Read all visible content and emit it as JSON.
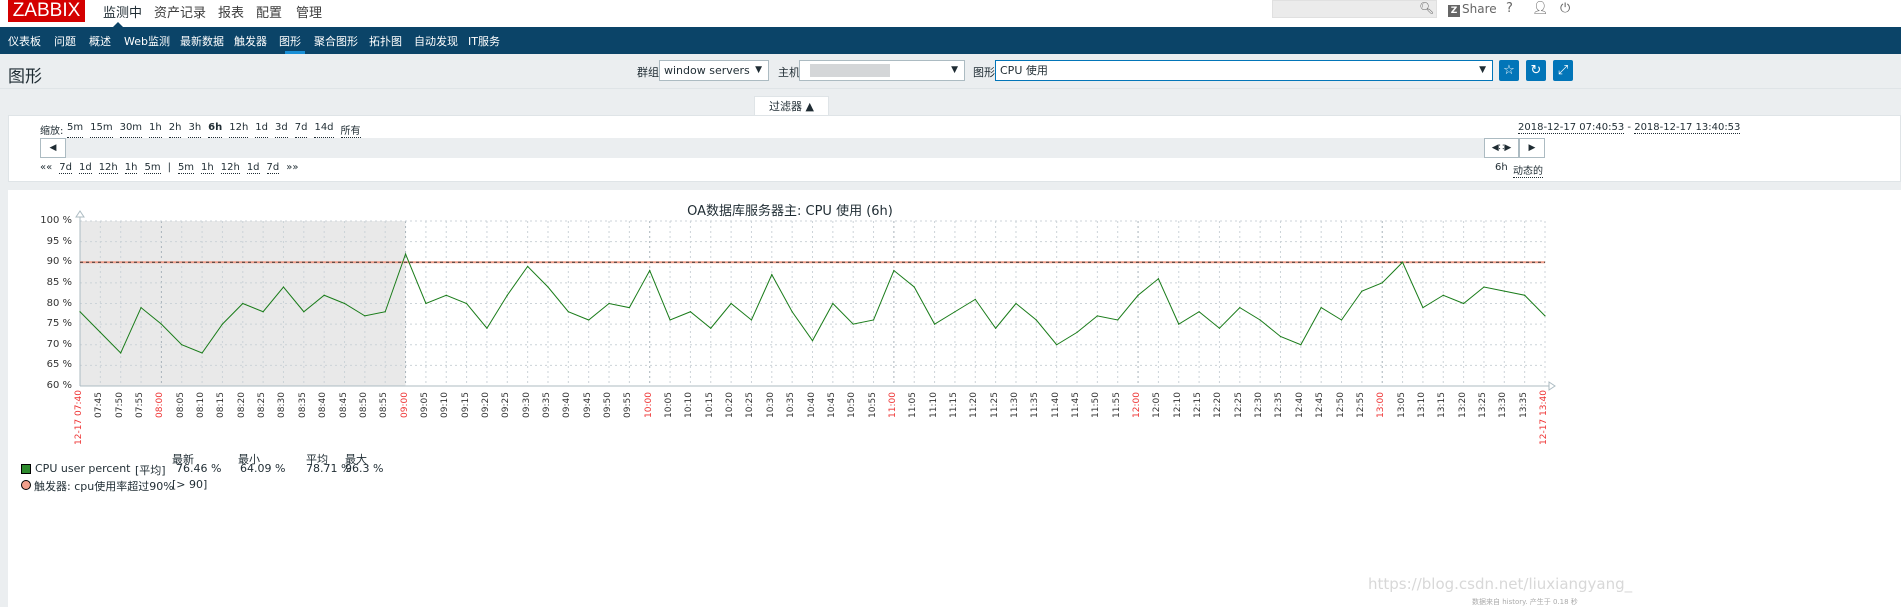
{
  "top": {
    "logo": "ZABBIX",
    "menu": [
      "监测中",
      "资产记录",
      "报表",
      "配置",
      "管理"
    ],
    "active_menu": "监测中",
    "share": "Share",
    "help": "?",
    "search_placeholder": ""
  },
  "nav": {
    "items": [
      "仪表板",
      "问题",
      "概述",
      "Web监测",
      "最新数据",
      "触发器",
      "图形",
      "聚合图形",
      "拓扑图",
      "自动发现",
      "IT服务"
    ],
    "active": "图形"
  },
  "header": {
    "title": "图形",
    "group_label": "群组",
    "group_value": "window servers",
    "host_label": "主机",
    "host_value": "",
    "graph_label": "图形",
    "graph_value": "CPU 使用"
  },
  "filter": {
    "tab": "过滤器 ▲",
    "zoom_label": "缩放:",
    "zoom_options": [
      "5m",
      "15m",
      "30m",
      "1h",
      "2h",
      "3h",
      "6h",
      "12h",
      "1d",
      "3d",
      "7d",
      "14d",
      "所有"
    ],
    "zoom_active": "6h",
    "from": "2018-12-17 07:40:53",
    "to": "2018-12-17 13:40:53",
    "sep": "-",
    "nav_back": [
      "««",
      "7d",
      "1d",
      "12h",
      "1h",
      "5m",
      "|",
      "5m",
      "1h",
      "12h",
      "1d",
      "7d",
      "»»"
    ],
    "period": "6h",
    "mode": "动态的"
  },
  "chart_data": {
    "type": "line",
    "title": "OA数据库服务器主: CPU 使用 (6h)",
    "ylim": [
      60,
      100
    ],
    "yticks": [
      "60 %",
      "65 %",
      "70 %",
      "75 %",
      "80 %",
      "85 %",
      "90 %",
      "95 %",
      "100 %"
    ],
    "x_start": "12-17 07:40",
    "x_end": "12-17 13:40",
    "xticks": [
      "07:45",
      "07:50",
      "07:55",
      "08:00",
      "08:05",
      "08:10",
      "08:15",
      "08:20",
      "08:25",
      "08:30",
      "08:35",
      "08:40",
      "08:45",
      "08:50",
      "08:55",
      "09:00",
      "09:05",
      "09:10",
      "09:15",
      "09:20",
      "09:25",
      "09:30",
      "09:35",
      "09:40",
      "09:45",
      "09:50",
      "09:55",
      "10:00",
      "10:05",
      "10:10",
      "10:15",
      "10:20",
      "10:25",
      "10:30",
      "10:35",
      "10:40",
      "10:45",
      "10:50",
      "10:55",
      "11:00",
      "11:05",
      "11:10",
      "11:15",
      "11:20",
      "11:25",
      "11:30",
      "11:35",
      "11:40",
      "11:45",
      "11:50",
      "11:55",
      "12:00",
      "12:05",
      "12:10",
      "12:15",
      "12:20",
      "12:25",
      "12:30",
      "12:35",
      "12:40",
      "12:45",
      "12:50",
      "12:55",
      "13:00",
      "13:05",
      "13:10",
      "13:15",
      "13:20",
      "13:25",
      "13:30",
      "13:35"
    ],
    "grid": true,
    "shaded_until": "09:00",
    "series": [
      {
        "name": "CPU user percent",
        "color": "#1a7c1a",
        "values": [
          78,
          73,
          68,
          79,
          75,
          70,
          68,
          75,
          80,
          78,
          84,
          78,
          82,
          80,
          77,
          78,
          92,
          80,
          82,
          80,
          74,
          82,
          89,
          84,
          78,
          76,
          80,
          79,
          88,
          76,
          78,
          74,
          80,
          76,
          87,
          78,
          71,
          80,
          75,
          76,
          88,
          84,
          75,
          78,
          81,
          74,
          80,
          76,
          70,
          73,
          77,
          76,
          82,
          86,
          75,
          78,
          74,
          79,
          76,
          72,
          70,
          79,
          76,
          83,
          85,
          90,
          79,
          82,
          80,
          84,
          83,
          82,
          77
        ]
      }
    ],
    "trigger": {
      "value": 90,
      "color": "#f2a08c"
    }
  },
  "legend": {
    "headers": [
      "最新",
      "最小",
      "平均",
      "最大"
    ],
    "item": {
      "name": "CPU user percent",
      "func": "[平均]",
      "last": "76.46 %",
      "min": "64.09 %",
      "avg": "78.71 %",
      "max": "96.3 %",
      "color": "#2d8a2d"
    },
    "trigger": {
      "name": "触发器: cpu使用率超过90%",
      "cond": "[> 90]",
      "color": "#f2a08c"
    }
  },
  "watermark": "https://blog.csdn.net/liuxiangyang_",
  "footer": "数据来自 history. 产生于 0.18 秒"
}
